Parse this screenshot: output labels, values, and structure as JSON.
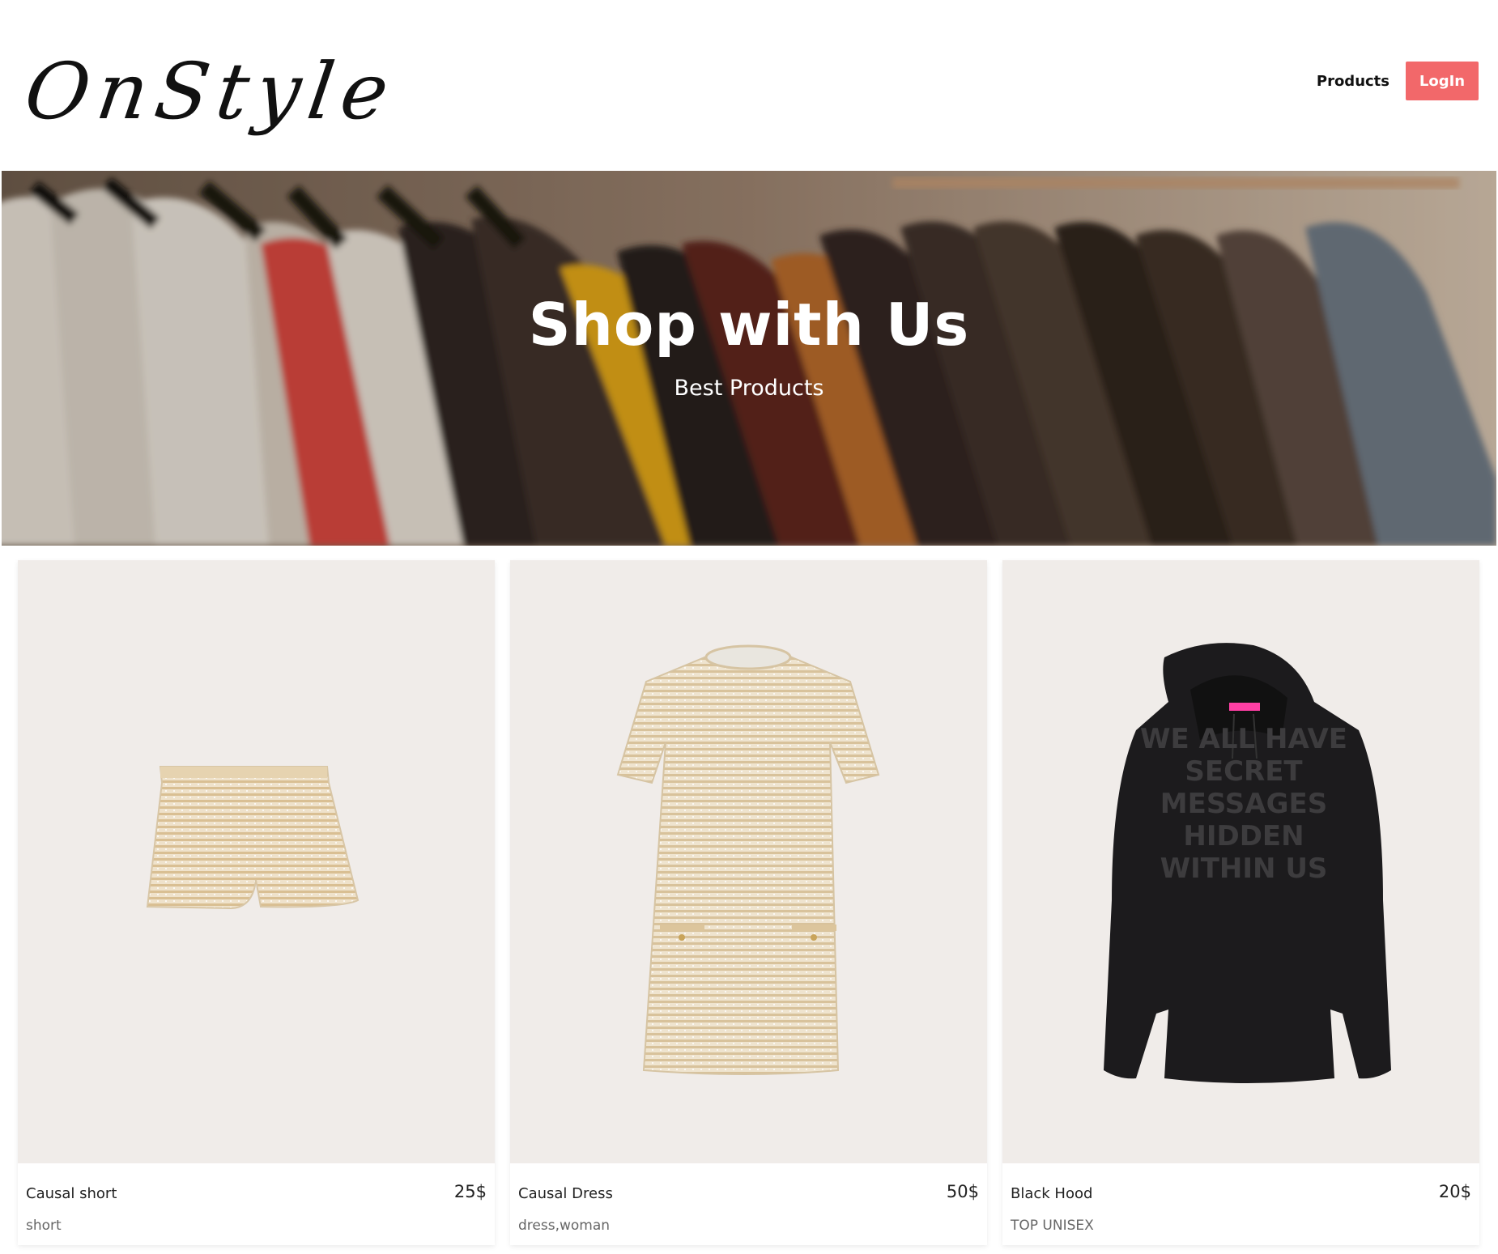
{
  "header": {
    "logo_text": "OnStyle",
    "nav": {
      "products_label": "Products",
      "login_label": "LogIn"
    }
  },
  "hero": {
    "title": "Shop with Us",
    "subtitle": "Best Products"
  },
  "products": [
    {
      "name": "Causal short",
      "price": "25$",
      "tags": "short"
    },
    {
      "name": "Causal Dress",
      "price": "50$",
      "tags": "dress,woman"
    },
    {
      "name": "Black Hood",
      "price": "20$",
      "tags": "TOP UNISEX"
    }
  ],
  "colors": {
    "login_button": "#f2686a",
    "product_bg": "#f0ece9",
    "hoodie_tag": "#ff3fa4"
  },
  "hoodie_print": [
    "WE ALL HAVE",
    "SECRET",
    "MESSAGES",
    "HIDDEN",
    "WITHIN US"
  ]
}
